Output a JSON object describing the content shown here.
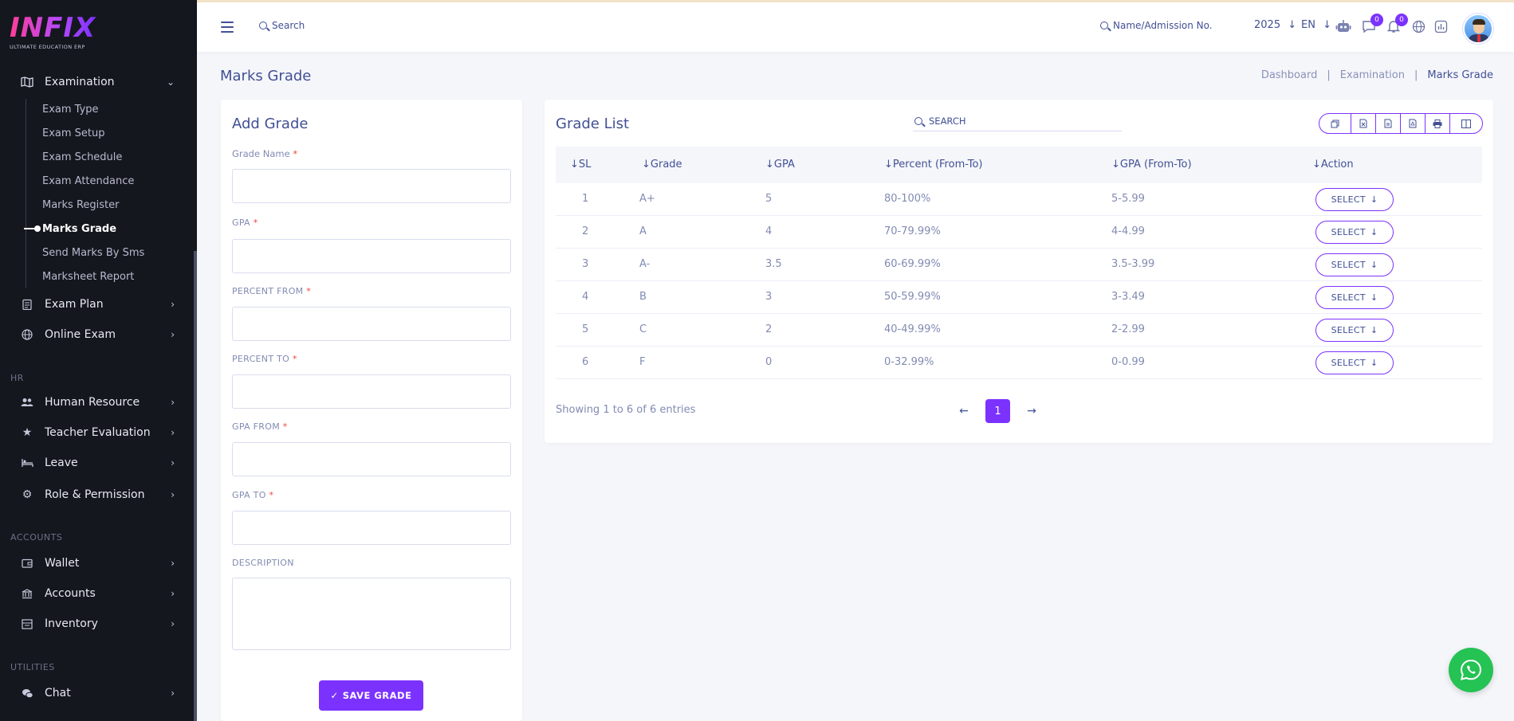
{
  "brand": {
    "logo": "INFIX",
    "tagline": "ULTIMATE EDUCATION ERP",
    "accent": "#7c32ff",
    "sidebar_bg": "#15171e"
  },
  "sidebar": {
    "examination": {
      "label": "Examination",
      "icon": "map-icon"
    },
    "exam_sub": [
      {
        "label": "Exam Type"
      },
      {
        "label": "Exam Setup"
      },
      {
        "label": "Exam Schedule"
      },
      {
        "label": "Exam Attendance"
      },
      {
        "label": "Marks Register"
      },
      {
        "label": "Marks Grade",
        "active": true
      },
      {
        "label": "Send Marks By Sms"
      },
      {
        "label": "Marksheet Report"
      }
    ],
    "exam_plan": {
      "label": "Exam Plan",
      "icon": "clipboard-icon"
    },
    "online_exam": {
      "label": "Online Exam",
      "icon": "globe-icon"
    },
    "section_hr": "HR",
    "human_resource": {
      "label": "Human Resource",
      "icon": "users-icon"
    },
    "teacher_evaluation": {
      "label": "Teacher Evaluation",
      "icon": "star-icon"
    },
    "leave": {
      "label": "Leave",
      "icon": "bed-icon"
    },
    "role_permission": {
      "label": "Role & Permission",
      "icon": "gear-icon"
    },
    "section_accounts": "ACCOUNTS",
    "wallet": {
      "label": "Wallet",
      "icon": "wallet-icon"
    },
    "accounts": {
      "label": "Accounts",
      "icon": "bank-icon"
    },
    "inventory": {
      "label": "Inventory",
      "icon": "inventory-icon"
    },
    "section_utilities": "UTILITIES",
    "chat": {
      "label": "Chat",
      "icon": "chat-icon"
    }
  },
  "topbar": {
    "search_label": "Search",
    "admission_search": "Name/Admission No.",
    "year": "2025",
    "language": "EN",
    "chat_badge": "0",
    "notification_badge": "0"
  },
  "page": {
    "title": "Marks Grade",
    "breadcrumb": [
      "Dashboard",
      "Examination",
      "Marks Grade"
    ],
    "separator": "|"
  },
  "add_grade": {
    "title": "Add Grade",
    "fields": {
      "grade_name": "Grade Name",
      "gpa": "GPA",
      "percent_from": "PERCENT FROM",
      "percent_to": "PERCENT TO",
      "gpa_from": "GPA FROM",
      "gpa_to": "GPA TO",
      "description": "DESCRIPTION"
    },
    "required_mark": "*",
    "save_label": "SAVE GRADE"
  },
  "grade_list": {
    "title": "Grade List",
    "search_placeholder": "SEARCH",
    "columns": [
      "SL",
      "Grade",
      "GPA",
      "Percent (From-To)",
      "GPA (From-To)",
      "Action"
    ],
    "rows": [
      {
        "sl": "1",
        "grade": "A+",
        "gpa": "5",
        "percent": "80-100%",
        "gpa_range": "5-5.99",
        "action": "SELECT"
      },
      {
        "sl": "2",
        "grade": "A",
        "gpa": "4",
        "percent": "70-79.99%",
        "gpa_range": "4-4.99",
        "action": "SELECT"
      },
      {
        "sl": "3",
        "grade": "A-",
        "gpa": "3.5",
        "percent": "60-69.99%",
        "gpa_range": "3.5-3.99",
        "action": "SELECT"
      },
      {
        "sl": "4",
        "grade": "B",
        "gpa": "3",
        "percent": "50-59.99%",
        "gpa_range": "3-3.49",
        "action": "SELECT"
      },
      {
        "sl": "5",
        "grade": "C",
        "gpa": "2",
        "percent": "40-49.99%",
        "gpa_range": "2-2.99",
        "action": "SELECT"
      },
      {
        "sl": "6",
        "grade": "F",
        "gpa": "0",
        "percent": "0-32.99%",
        "gpa_range": "0-0.99",
        "action": "SELECT"
      }
    ],
    "entries_info": "Showing 1 to 6 of 6 entries",
    "current_page": "1"
  }
}
